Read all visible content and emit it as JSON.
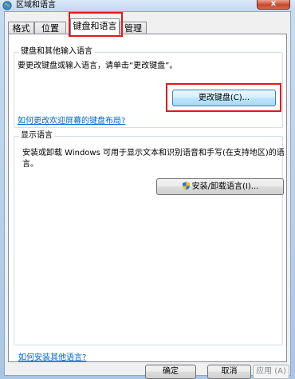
{
  "window": {
    "title": "区域和语言",
    "close_label": "x"
  },
  "tabs": [
    {
      "label": "格式"
    },
    {
      "label": "位置"
    },
    {
      "label": "键盘和语言",
      "active": true
    },
    {
      "label": "管理"
    }
  ],
  "keyboards_group": {
    "legend": "键盘和其他输入语言",
    "description": "要更改键盘或输入语言，请单击“更改键盘”。",
    "change_button": "更改键盘(C)...",
    "welcome_link": "如何更改欢迎屏幕的键盘布局?"
  },
  "display_group": {
    "legend": "显示语言",
    "description_line1": "安装或卸载 Windows 可用于显示文本和识别语音和手写(在支持地区)的语",
    "description_line2": "言。",
    "install_button": "安装/卸载语言(I)..."
  },
  "install_link": "如何安装其他语言?",
  "footer": {
    "ok": "确定",
    "cancel": "取消",
    "apply": "应用 (A)"
  },
  "colors": {
    "highlight": "#e0191d",
    "link": "#0066cc"
  }
}
